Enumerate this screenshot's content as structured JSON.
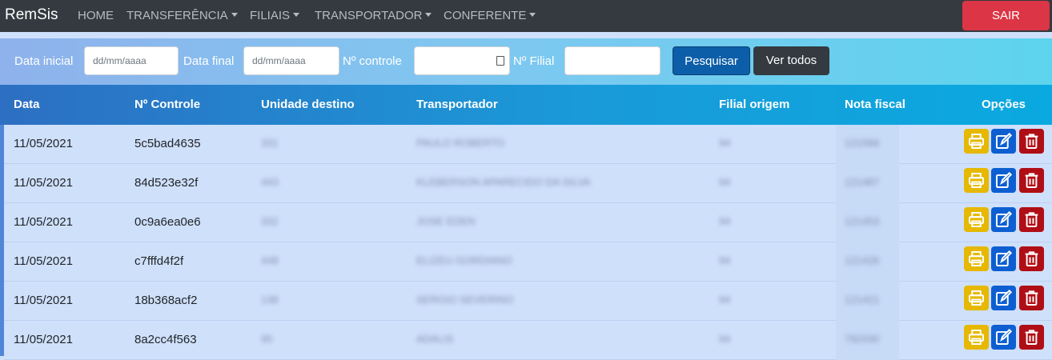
{
  "navbar": {
    "brand": "RemSis",
    "items": [
      {
        "label": "HOME",
        "dropdown": false
      },
      {
        "label": "TRANSFERÊNCIA",
        "dropdown": true
      },
      {
        "label": "FILIAIS",
        "dropdown": true
      },
      {
        "label": "TRANSPORTADOR",
        "dropdown": true
      },
      {
        "label": "CONFERENTE",
        "dropdown": true
      }
    ],
    "logout_label": "SAIR"
  },
  "filters": {
    "date_start_label": "Data inicial",
    "date_start_placeholder": "dd/mm/aaaa",
    "date_end_label": "Data final",
    "date_end_placeholder": "dd/mm/aaaa",
    "control_label": "Nº controle",
    "control_value": "",
    "branch_label": "Nº Filial",
    "branch_value": "",
    "search_label": "Pesquisar",
    "view_all_label": "Ver todos"
  },
  "table": {
    "headers": [
      "Data",
      "Nº Controle",
      "Unidade destino",
      "Transportador",
      "Filial origem",
      "Nota fiscal",
      "Opções"
    ],
    "rows": [
      {
        "data": "11/05/2021",
        "controle": "5c5bad4635",
        "unidade": "331",
        "transportador": "PAULO ROBERTO",
        "filial": "94",
        "nota": "121566"
      },
      {
        "data": "11/05/2021",
        "controle": "84d523e32f",
        "unidade": "443",
        "transportador": "KLEBERSON APARECIDO DA SILVA",
        "filial": "94",
        "nota": "121487"
      },
      {
        "data": "11/05/2021",
        "controle": "0c9a6ea0e6",
        "unidade": "332",
        "transportador": "JOSE EDEN",
        "filial": "94",
        "nota": "121453"
      },
      {
        "data": "11/05/2021",
        "controle": "c7fffd4f2f",
        "unidade": "448",
        "transportador": "ELIZEU GORDIANO",
        "filial": "94",
        "nota": "121426"
      },
      {
        "data": "11/05/2021",
        "controle": "18b368acf2",
        "unidade": "138",
        "transportador": "SERGIO SEVERINO",
        "filial": "94",
        "nota": "121421"
      },
      {
        "data": "11/05/2021",
        "controle": "8a2cc4f563",
        "unidade": "95",
        "transportador": "ADALIS",
        "filial": "94",
        "nota": "792430"
      }
    ]
  },
  "colors": {
    "navbar": "#343a40",
    "logout": "#dc3545",
    "search_button": "#0d5ea8",
    "print_action": "#e6b800",
    "edit_action": "#0d5fd1",
    "delete_action": "#b00e16",
    "row_bg": "#cfe0fb"
  },
  "icons": {
    "print": "printer-icon",
    "edit": "edit-icon",
    "delete": "trash-icon",
    "calendar": "calendar-icon"
  }
}
